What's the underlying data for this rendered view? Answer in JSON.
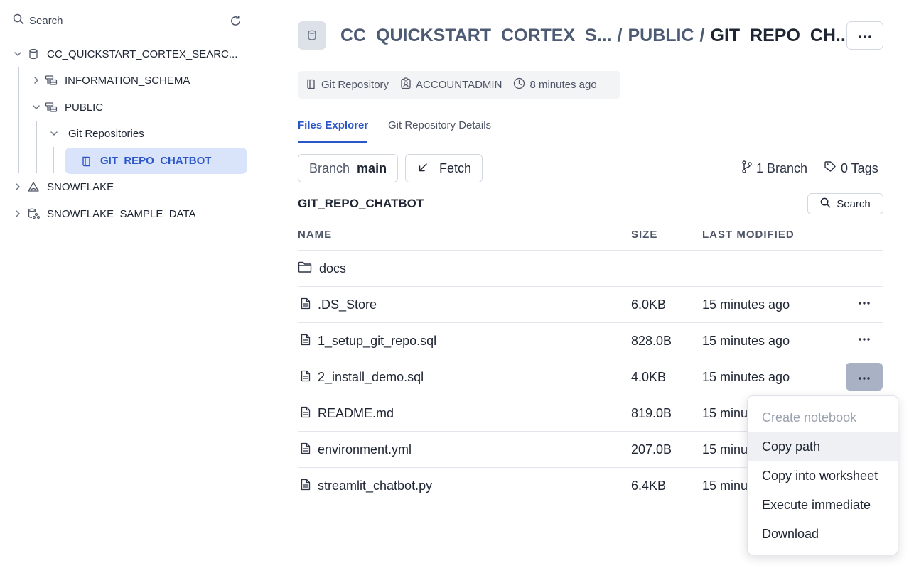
{
  "sidebar": {
    "search_label": "Search",
    "tree": {
      "database": "CC_QUICKSTART_CORTEX_SEARC...",
      "schema_1": "INFORMATION_SCHEMA",
      "schema_2": "PUBLIC",
      "group": "Git Repositories",
      "selected_repo": "GIT_REPO_CHATBOT",
      "db_2": "SNOWFLAKE",
      "db_3": "SNOWFLAKE_SAMPLE_DATA"
    }
  },
  "header": {
    "crumb_db": "CC_QUICKSTART_CORTEX_S...",
    "separator": "/",
    "crumb_schema": "PUBLIC",
    "crumb_current": "GIT_REPO_CH..."
  },
  "meta": {
    "type": "Git Repository",
    "owner": "ACCOUNTADMIN",
    "modified": "8 minutes ago"
  },
  "tabs": {
    "files_explorer": "Files Explorer",
    "details": "Git Repository Details"
  },
  "toolbar": {
    "branch_label": "Branch",
    "branch_value": "main",
    "fetch_label": "Fetch",
    "branches_count": "1 Branch",
    "tags_count": "0 Tags"
  },
  "section": {
    "title": "GIT_REPO_CHATBOT",
    "search_label": "Search"
  },
  "table": {
    "headers": {
      "name": "NAME",
      "size": "SIZE",
      "modified": "LAST MODIFIED"
    },
    "rows": [
      {
        "name": "docs",
        "size": "",
        "modified": "",
        "kind": "folder-icon"
      },
      {
        "name": ".DS_Store",
        "size": "6.0KB",
        "modified": "15 minutes ago",
        "kind": "file-icon"
      },
      {
        "name": "1_setup_git_repo.sql",
        "size": "828.0B",
        "modified": "15 minutes ago",
        "kind": "file-icon"
      },
      {
        "name": "2_install_demo.sql",
        "size": "4.0KB",
        "modified": "15 minutes ago",
        "kind": "file-icon"
      },
      {
        "name": "README.md",
        "size": "819.0B",
        "modified": "15 minu",
        "kind": "file-icon"
      },
      {
        "name": "environment.yml",
        "size": "207.0B",
        "modified": "15 minu",
        "kind": "file-icon"
      },
      {
        "name": "streamlit_chatbot.py",
        "size": "6.4KB",
        "modified": "15 minu",
        "kind": "file-icon"
      }
    ]
  },
  "menu": {
    "items": [
      "Create notebook",
      "Copy path",
      "Copy into worksheet",
      "Execute immediate",
      "Download"
    ]
  },
  "colors": {
    "accent": "#2b56c6",
    "selected_bg": "#d9e4fb",
    "active_more_bg": "#a9b2c5"
  }
}
